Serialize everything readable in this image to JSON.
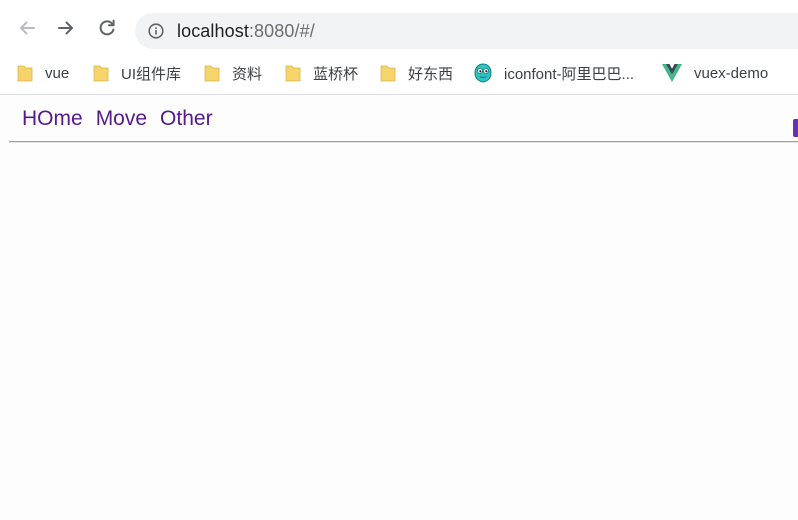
{
  "browser": {
    "address_bar": {
      "host": "localhost",
      "path": ":8080/#/"
    },
    "bookmarks": [
      {
        "label": "vue",
        "icon": "folder-icon"
      },
      {
        "label": "UI组件库",
        "icon": "folder-icon"
      },
      {
        "label": "资料",
        "icon": "folder-icon"
      },
      {
        "label": "蓝桥杯",
        "icon": "folder-icon"
      },
      {
        "label": "好东西",
        "icon": "folder-icon"
      },
      {
        "label": "iconfont-阿里巴巴...",
        "icon": "iconfont-favicon"
      },
      {
        "label": "vuex-demo",
        "icon": "vue-logo-icon"
      }
    ]
  },
  "app": {
    "nav": [
      {
        "label": "HOme"
      },
      {
        "label": "Move"
      },
      {
        "label": "Other"
      }
    ]
  },
  "colors": {
    "visited_link": "#551a8b",
    "folder": "#f5d46b",
    "vue_green": "#41b883",
    "vue_dark": "#35495e"
  }
}
